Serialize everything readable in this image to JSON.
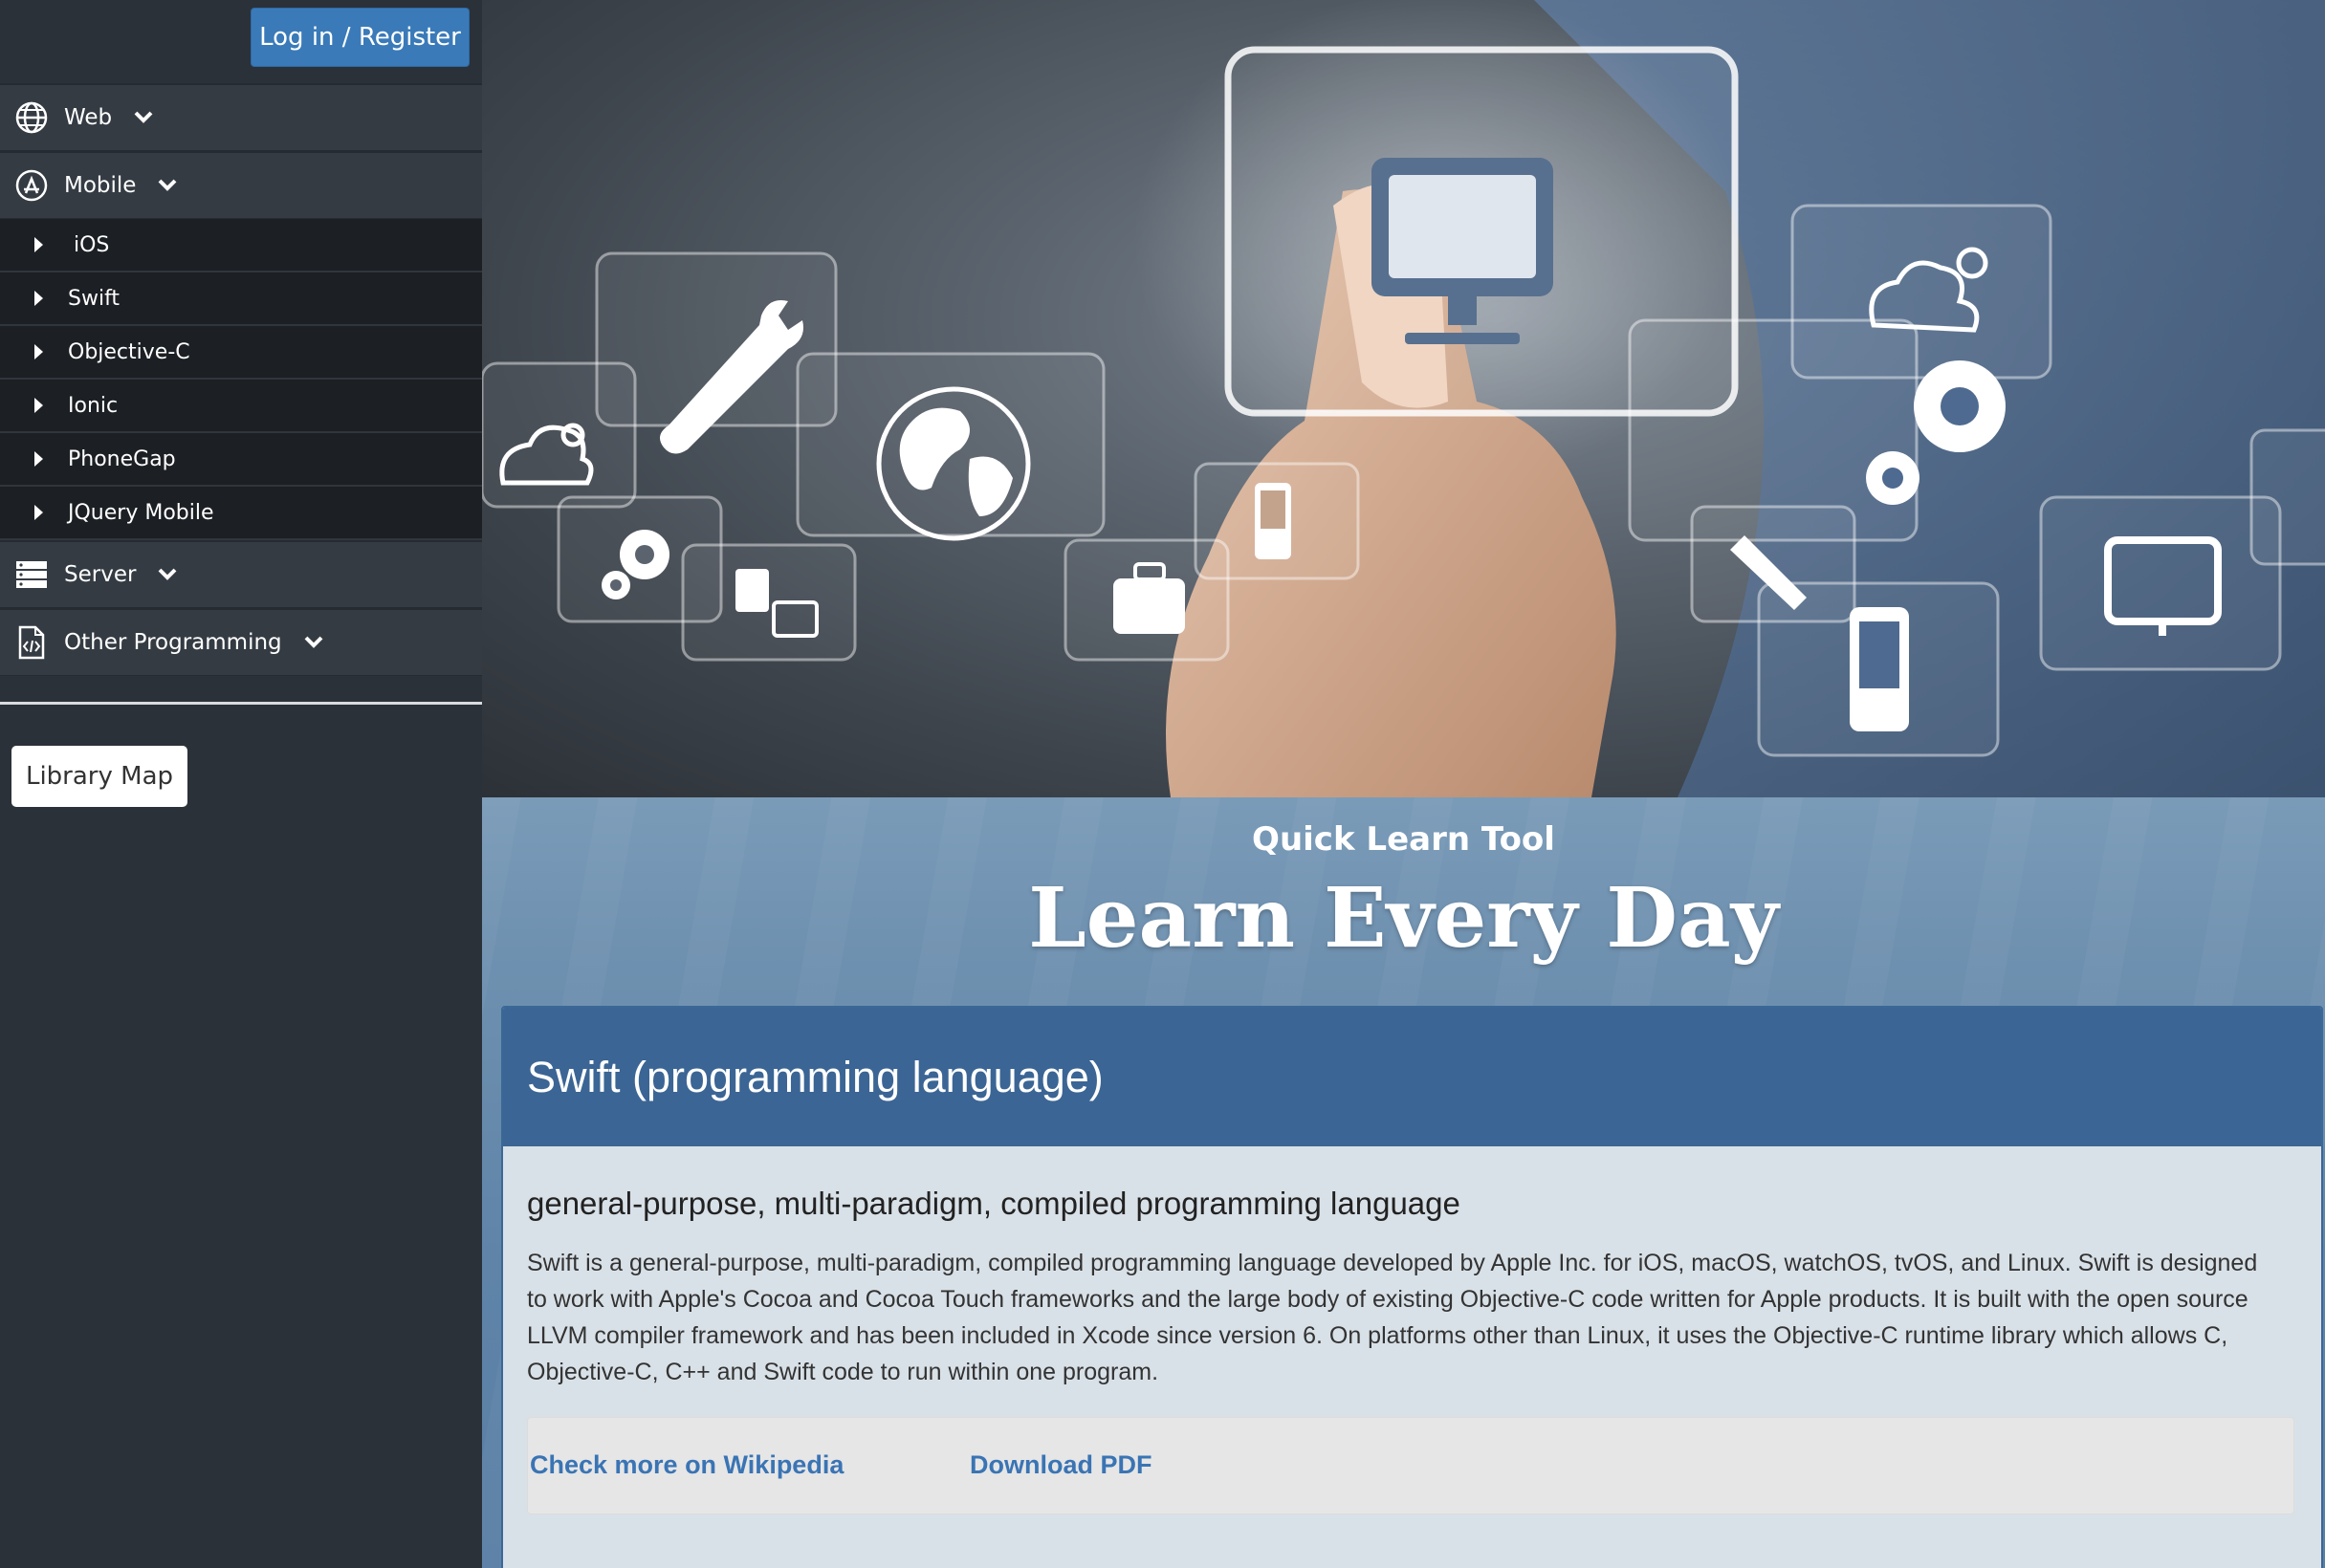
{
  "auth": {
    "login_label": "Log in / Register"
  },
  "sidebar": {
    "groups": [
      {
        "label": "Web",
        "icon": "globe-icon"
      },
      {
        "label": "Mobile",
        "icon": "app-store-icon"
      },
      {
        "label": "Server",
        "icon": "server-icon"
      },
      {
        "label": "Other Programming",
        "icon": "code-file-icon"
      }
    ],
    "mobile_items": [
      "iOS",
      "Swift",
      "Objective-C",
      "Ionic",
      "PhoneGap",
      "JQuery Mobile"
    ],
    "library_map_label": "Library Map"
  },
  "hero": {
    "description_icons": [
      "monitor-icon",
      "wrench-icon",
      "globe-icon",
      "cloud-gear-icon",
      "gear-icon",
      "phone-icon",
      "briefcase-icon",
      "transfer-icon"
    ]
  },
  "banner": {
    "kicker": "Quick Learn Tool",
    "headline": "Learn Every Day"
  },
  "article": {
    "title": "Swift (programming language)",
    "subtitle": "general-purpose, multi-paradigm, compiled programming language",
    "body": "Swift is a general-purpose, multi-paradigm, compiled programming language developed by Apple Inc. for iOS, macOS, watchOS, tvOS, and Linux. Swift is designed to work with Apple's Cocoa and Cocoa Touch frameworks and the large body of existing Objective-C code written for Apple products. It is built with the open source LLVM compiler framework and has been included in Xcode since version 6. On platforms other than Linux, it uses the Objective-C runtime library which allows C, Objective-C, C++ and Swift code to run within one program.",
    "links": {
      "wikipedia": "Check more on Wikipedia",
      "pdf": "Download PDF"
    }
  },
  "colors": {
    "primary": "#3a7ab8",
    "panel_header": "#3b6594",
    "sidebar_bg": "#2b3138",
    "link": "#3a74b4"
  }
}
